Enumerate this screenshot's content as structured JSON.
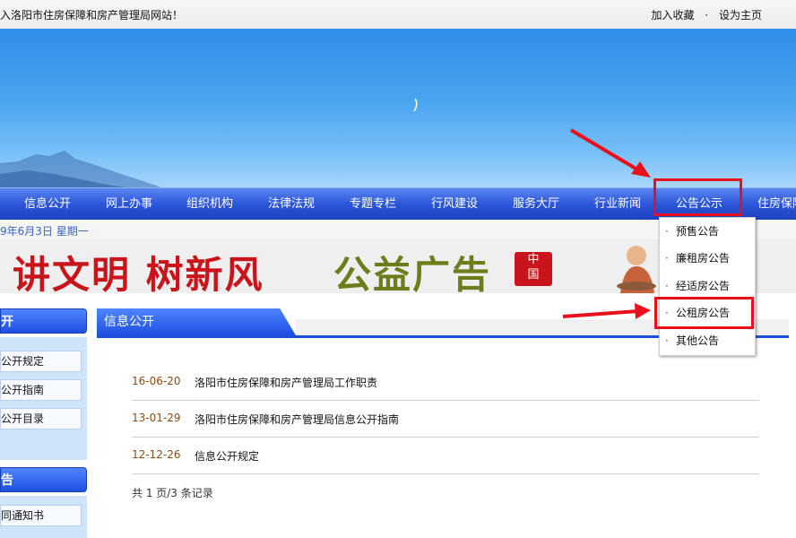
{
  "top": {
    "welcome": "入洛阳市住房保障和房产管理局网站！",
    "add_favorite": "加入收藏",
    "separator": "·",
    "set_home": "设为主页"
  },
  "nav": {
    "items": [
      "信息公开",
      "网上办事",
      "组织机构",
      "法律法规",
      "专题专栏",
      "行风建设",
      "服务大厅",
      "行业新闻",
      "公告公示",
      "住房保障"
    ]
  },
  "date": "9年6月3日 星期一",
  "ad": {
    "slogan1": "讲文明 树新风",
    "slogan2": "公益广告",
    "logo_top": "中",
    "logo_bottom": "国"
  },
  "sidebar": {
    "section1_title": "开",
    "section1_links": [
      "公开规定",
      "公开指南",
      "公开目录"
    ],
    "section2_title": "告",
    "section2_links": [
      "同通知书"
    ]
  },
  "main": {
    "tab_title": "信息公开",
    "rows": [
      {
        "date": "16-06-20",
        "title": "洛阳市住房保障和房产管理局工作职责"
      },
      {
        "date": "13-01-29",
        "title": "洛阳市住房保障和房产管理局信息公开指南"
      },
      {
        "date": "12-12-26",
        "title": "信息公开规定"
      }
    ],
    "summary": "共 1 页/3 条记录"
  },
  "dropdown": {
    "bullet": "·",
    "items": [
      "预售公告",
      "廉租房公告",
      "经适房公告",
      "公租房公告",
      "其他公告"
    ]
  },
  "colors": {
    "nav_blue": "#2c57d9",
    "highlight_red": "#e8101a",
    "date_brown": "#8b4a12"
  }
}
